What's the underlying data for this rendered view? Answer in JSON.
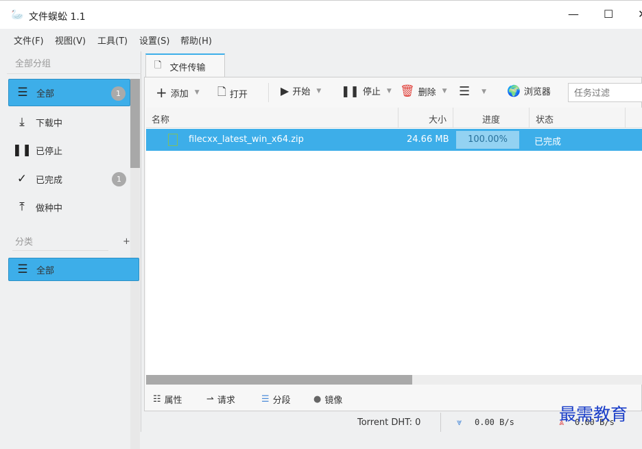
{
  "window": {
    "title": "文件蜈蚣 1.1",
    "minimize": "—",
    "maximize": "☐",
    "close": "✕"
  },
  "menu": [
    "文件(F)",
    "视图(V)",
    "工具(T)",
    "设置(S)",
    "帮助(H)"
  ],
  "sidebar": {
    "group_header": "全部分组",
    "items": [
      {
        "label": "全部",
        "icon": "menu-icon",
        "badge": "1",
        "selected": true
      },
      {
        "label": "下载中",
        "icon": "download-icon"
      },
      {
        "label": "已停止",
        "icon": "pause-icon"
      },
      {
        "label": "已完成",
        "icon": "check-icon",
        "badge": "1"
      },
      {
        "label": "做种中",
        "icon": "upload-icon"
      }
    ],
    "category_header": "分类",
    "add": "+",
    "categories": [
      {
        "label": "全部",
        "icon": "menu-icon",
        "selected": true
      }
    ]
  },
  "tab": {
    "label": "文件传输"
  },
  "toolbar": {
    "add": "添加",
    "open": "打开",
    "start": "开始",
    "stop": "停止",
    "delete": "删除",
    "browser": "浏览器",
    "filter_placeholder": "任务过滤"
  },
  "table": {
    "columns": [
      "名称",
      "大小",
      "进度",
      "状态"
    ],
    "rows": [
      {
        "name": "filecxx_latest_win_x64.zip",
        "size": "24.66 MB",
        "progress": "100.00%",
        "status": "已完成"
      }
    ]
  },
  "bottom_tabs": [
    "属性",
    "请求",
    "分段",
    "镜像"
  ],
  "status": {
    "dht": "Torrent DHT:  0",
    "down": "0.00 B/s",
    "up": "0.00 B/s"
  },
  "watermark": "最需教育",
  "colors": {
    "accent": "#3daee9",
    "delete": "#e0403a"
  }
}
